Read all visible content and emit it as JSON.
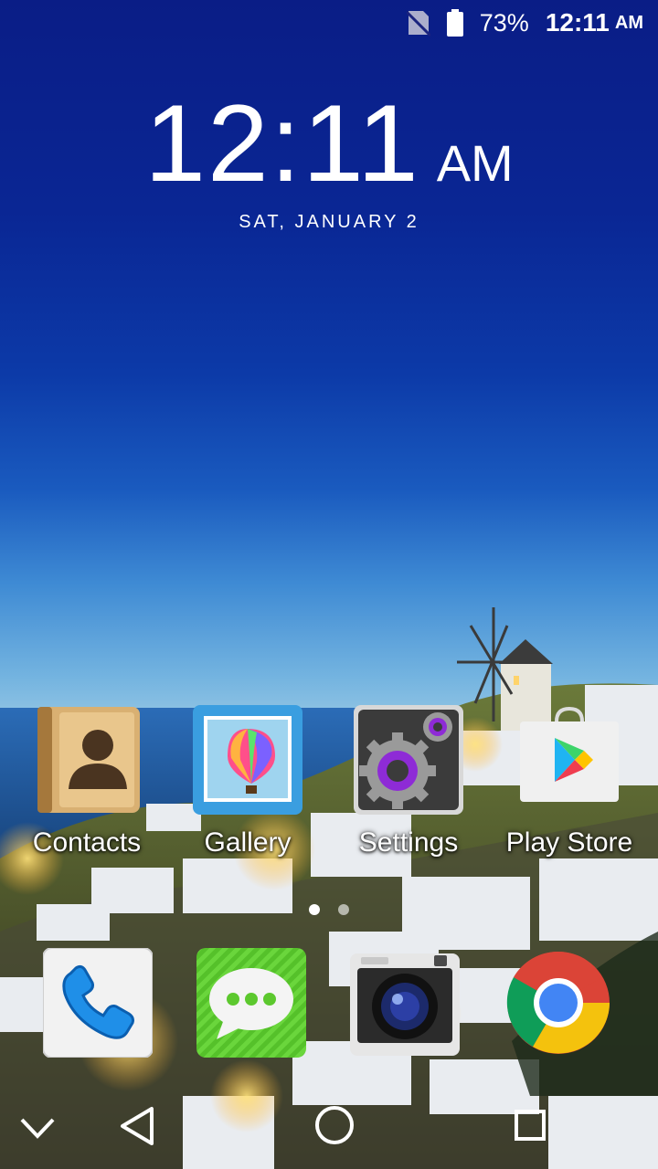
{
  "status_bar": {
    "battery_percent": "73%",
    "time": "12:11",
    "ampm": "AM"
  },
  "clock": {
    "time": "12:11",
    "ampm": "AM",
    "date": "SAT, JANUARY 2"
  },
  "home_apps": [
    {
      "label": "Contacts",
      "icon": "contacts-icon"
    },
    {
      "label": "Gallery",
      "icon": "gallery-icon"
    },
    {
      "label": "Settings",
      "icon": "settings-icon"
    },
    {
      "label": "Play Store",
      "icon": "play-store-icon"
    }
  ],
  "page_indicator": {
    "pages": 2,
    "current": 1
  },
  "dock_apps": [
    {
      "icon": "phone-icon"
    },
    {
      "icon": "messaging-icon"
    },
    {
      "icon": "camera-icon"
    },
    {
      "icon": "chrome-icon"
    }
  ],
  "nav_bar": {
    "buttons": [
      "collapse-icon",
      "back-icon",
      "home-icon",
      "recents-icon"
    ]
  }
}
